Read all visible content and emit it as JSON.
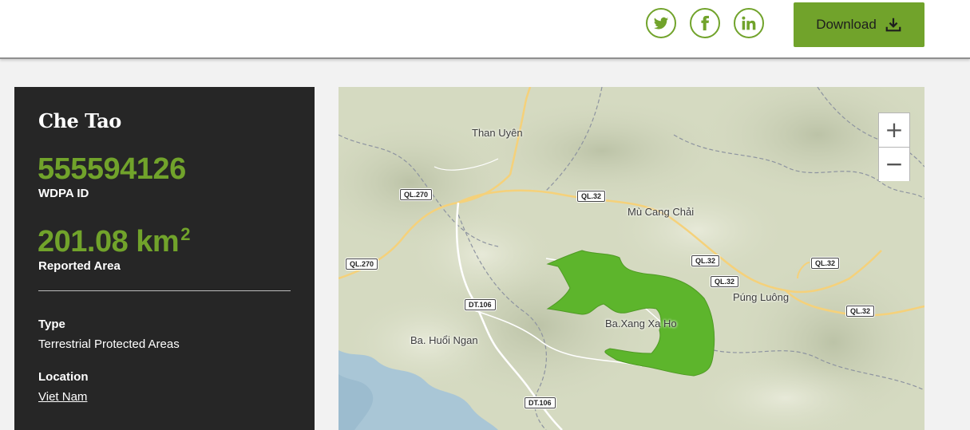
{
  "header": {
    "download_label": "Download",
    "share": [
      {
        "name": "twitter-icon"
      },
      {
        "name": "facebook-icon"
      },
      {
        "name": "linkedin-icon"
      }
    ]
  },
  "panel": {
    "name": "Che Tao",
    "wdpa_id": "555594126",
    "wdpa_id_label": "WDPA ID",
    "area_value": "201.08 km",
    "area_unit_sup": "2",
    "area_label": "Reported Area",
    "type_label": "Type",
    "type_value": "Terrestrial Protected Areas",
    "location_label": "Location",
    "location_value": "Viet Nam"
  },
  "map": {
    "places": {
      "than_uyen": "Than Uyên",
      "mu_cang_chai": "Mù Cang Chải",
      "pung_luong": "Púng Luông",
      "ba_xang": "Ba.Xang Xa Ho",
      "ba_huoi": "Ba. Huổi Ngan"
    },
    "roads": {
      "ql270_a": "QL.270",
      "ql270_b": "QL.270",
      "ql32_a": "QL.32",
      "ql32_b": "QL.32",
      "ql32_c": "QL.32",
      "ql32_d": "QL.32",
      "ql32_e": "QL.32",
      "dt106_a": "DT.106",
      "dt106_b": "DT.106"
    },
    "zoom_in": "+",
    "zoom_out": "−"
  },
  "colors": {
    "accent": "#71a32b",
    "panel_bg": "#262626",
    "protected_area": "#5db52c"
  }
}
